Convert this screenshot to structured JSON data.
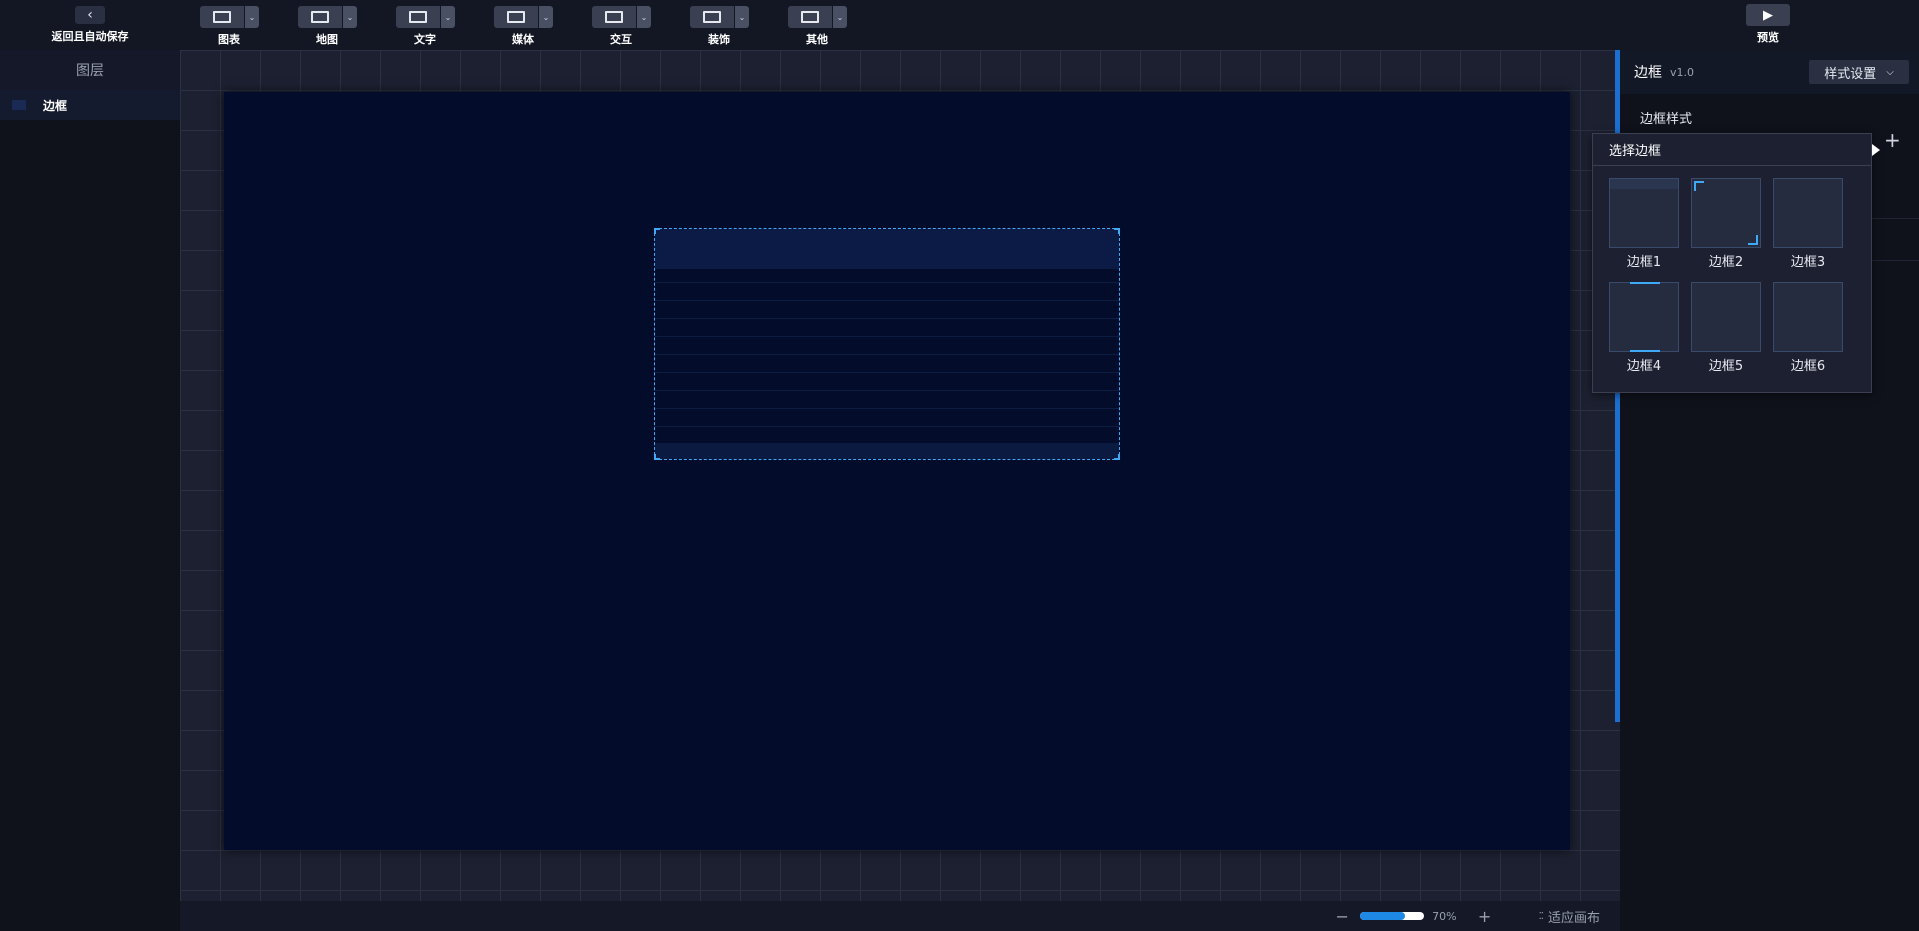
{
  "topbar": {
    "back_label": "返回且自动保存",
    "preview_label": "预览",
    "tools": [
      {
        "label": "图表",
        "icon": "chart-icon"
      },
      {
        "label": "地图",
        "icon": "map-icon"
      },
      {
        "label": "文字",
        "icon": "text-icon"
      },
      {
        "label": "媒体",
        "icon": "media-icon"
      },
      {
        "label": "交互",
        "icon": "interaction-icon"
      },
      {
        "label": "装饰",
        "icon": "decoration-icon"
      },
      {
        "label": "其他",
        "icon": "other-icon"
      }
    ]
  },
  "layers": {
    "title": "图层",
    "items": [
      {
        "name": "边框",
        "selected": true
      }
    ]
  },
  "statusbar": {
    "zoom_value": "70%",
    "zoom_level": 0.7,
    "fit_label": "适应画布"
  },
  "right_panel": {
    "title": "边框",
    "version": "v1.0",
    "style_select": "样式设置",
    "section_label": "边框样式"
  },
  "popup": {
    "title": "选择边框",
    "options": [
      "边框1",
      "边框2",
      "边框3",
      "边框4",
      "边框5",
      "边框6"
    ]
  },
  "colors": {
    "accent": "#1e88e5",
    "selection": "#3fa9f5",
    "canvas_bg": "#030d2b",
    "workspace_bg": "#1c2030"
  }
}
